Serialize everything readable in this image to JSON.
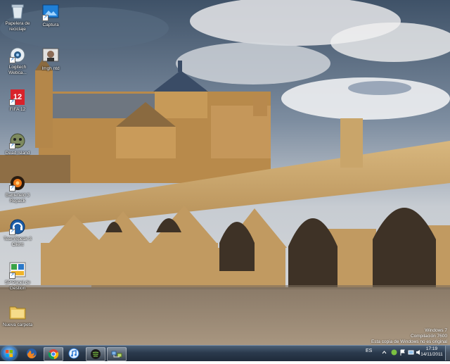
{
  "desktop": {
    "icons": [
      {
        "label": "Papelera de\nreciclaje",
        "icon": "recycle-bin-icon"
      },
      {
        "label": "Captura",
        "icon": "capture-icon"
      },
      {
        "label": "Logitech\nWebca...",
        "icon": "webcam-icon"
      },
      {
        "label": "Imgh ntd",
        "icon": "face-photo-icon"
      },
      {
        "label": "FIFA 12",
        "icon": "fifa-icon"
      },
      {
        "label": "Dead Island",
        "icon": "zombie-icon"
      },
      {
        "label": "Battlefield 3\nRepack",
        "icon": "battlefield-icon"
      },
      {
        "label": "TeamSpeak 3\nClient",
        "icon": "teamspeak-icon"
      },
      {
        "label": "SP Panel de\nGestion",
        "icon": "sp-panel-icon"
      },
      {
        "label": "Nueva carpeta",
        "icon": "folder-icon"
      }
    ]
  },
  "watermark": {
    "line1": "Windows 7",
    "line2": "Compilación 7600",
    "line3": "Esta copia de Windows no es original"
  },
  "taskbar": {
    "pinned": [
      "firefox-icon",
      "chrome-icon",
      "itunes-icon",
      "spotify-icon",
      "network-app-icon"
    ],
    "language": "ES",
    "time": "17:19",
    "date": "14/11/2011"
  },
  "colors": {
    "taskbar": "#2b3a4d",
    "sky": "#8a98a8",
    "stone": "#c9a46a",
    "river": "#9a8872"
  }
}
